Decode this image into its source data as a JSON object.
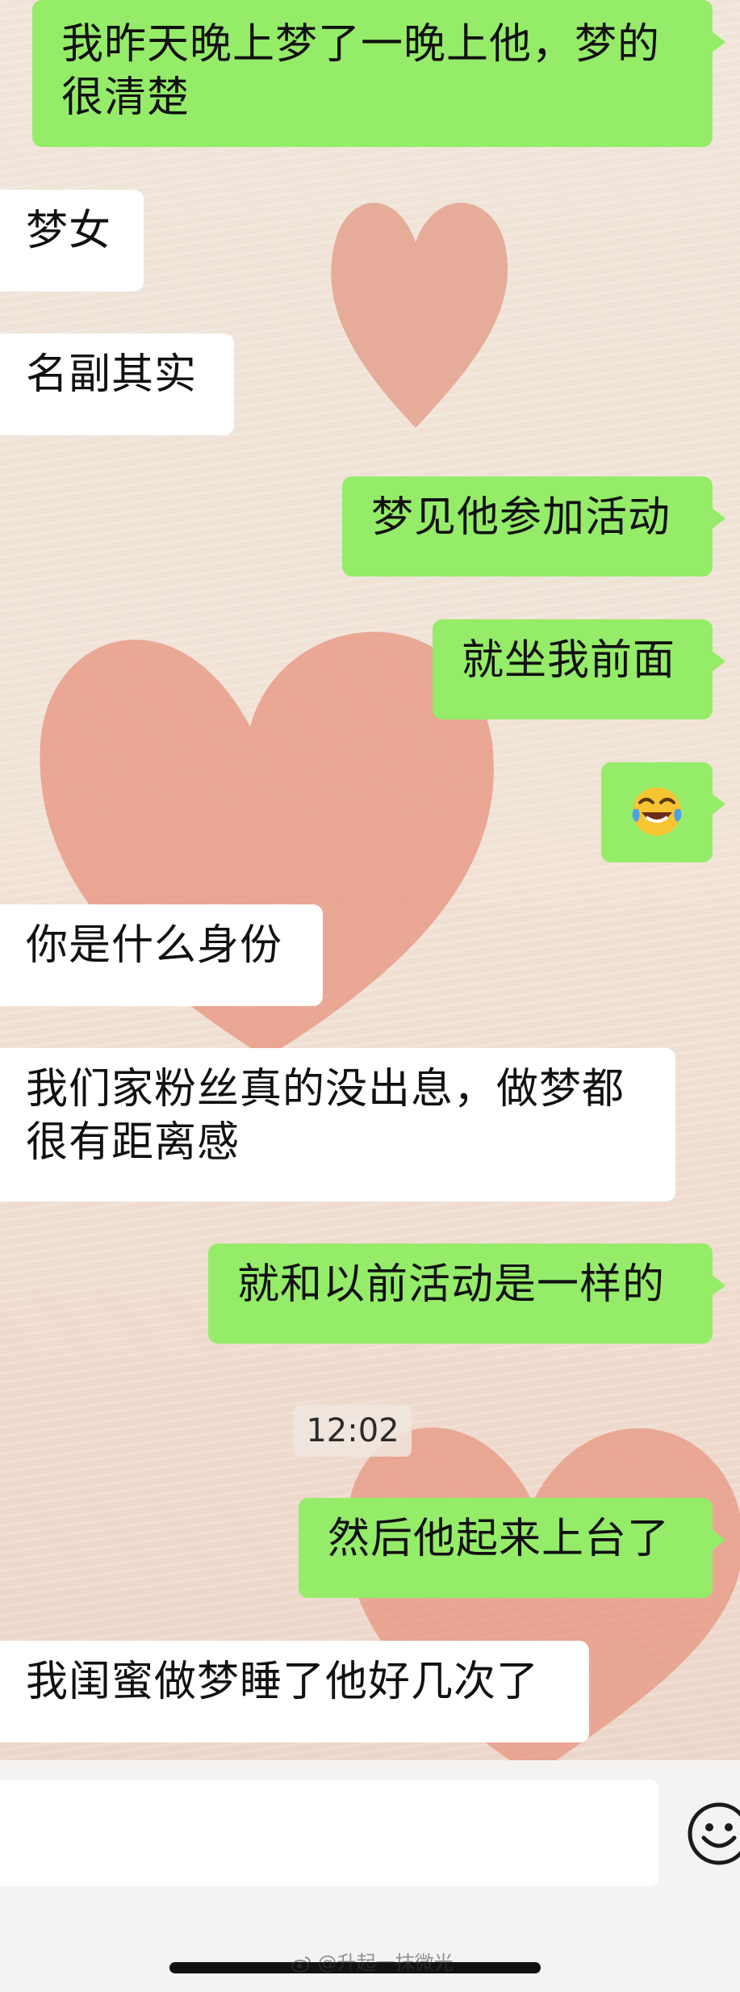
{
  "messages": [
    {
      "side": "out",
      "text": "我昨天晚上梦了一晚上他，梦的很清楚"
    },
    {
      "side": "in",
      "text": "梦女"
    },
    {
      "side": "in",
      "text": "名副其实"
    },
    {
      "side": "out",
      "text": "梦见他参加活动"
    },
    {
      "side": "out",
      "text": "就坐我前面"
    },
    {
      "side": "out",
      "emoji": "face-with-tears-of-joy"
    },
    {
      "side": "in",
      "text": "你是什么身份"
    },
    {
      "side": "in",
      "text": "我们家粉丝真的没出息，做梦都很有距离感"
    },
    {
      "side": "out",
      "text": "就和以前活动是一样的"
    },
    {
      "side": "out",
      "text": "然后他起来上台了"
    },
    {
      "side": "in",
      "text": "我闺蜜做梦睡了他好几次了"
    }
  ],
  "timestamp": "12:02",
  "watermark": "@升起一抹微光",
  "colors": {
    "outgoing_bubble": "#95ec69",
    "incoming_bubble": "#ffffff",
    "heart": "#e6907a"
  },
  "icons": {
    "input_emoji_button": "smiley-icon",
    "watermark_logo": "weibo-icon"
  }
}
